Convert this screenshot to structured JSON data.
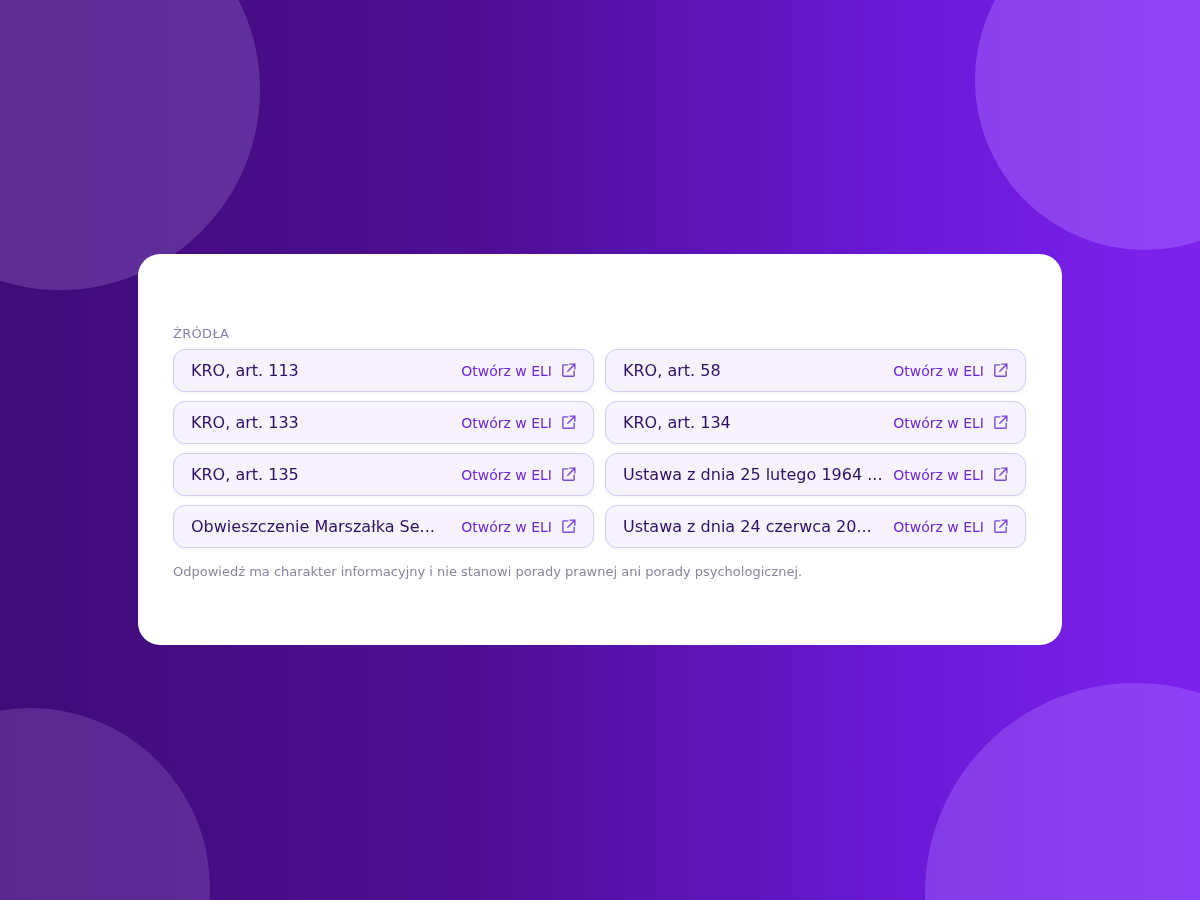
{
  "sources": {
    "heading": "ŹRÓDŁA",
    "items": [
      {
        "title": "KRO, art. 113",
        "link": "Otwórz w ELI"
      },
      {
        "title": "KRO, art. 58",
        "link": "Otwórz w ELI"
      },
      {
        "title": "KRO, art. 133",
        "link": "Otwórz w ELI"
      },
      {
        "title": "KRO, art. 134",
        "link": "Otwórz w ELI"
      },
      {
        "title": "KRO, art. 135",
        "link": "Otwórz w ELI"
      },
      {
        "title": "Ustawa z dnia 25 lutego 1964 ...",
        "link": "Otwórz w ELI"
      },
      {
        "title": "Obwieszczenie Marszałka Se...",
        "link": "Otwórz w ELI"
      },
      {
        "title": "Ustawa z dnia 24 czerwca 20...",
        "link": "Otwórz w ELI"
      }
    ],
    "disclaimer": "Odpowiedź ma charakter informacyjny i nie stanowi porady prawnej ani porady psychologicznej."
  }
}
